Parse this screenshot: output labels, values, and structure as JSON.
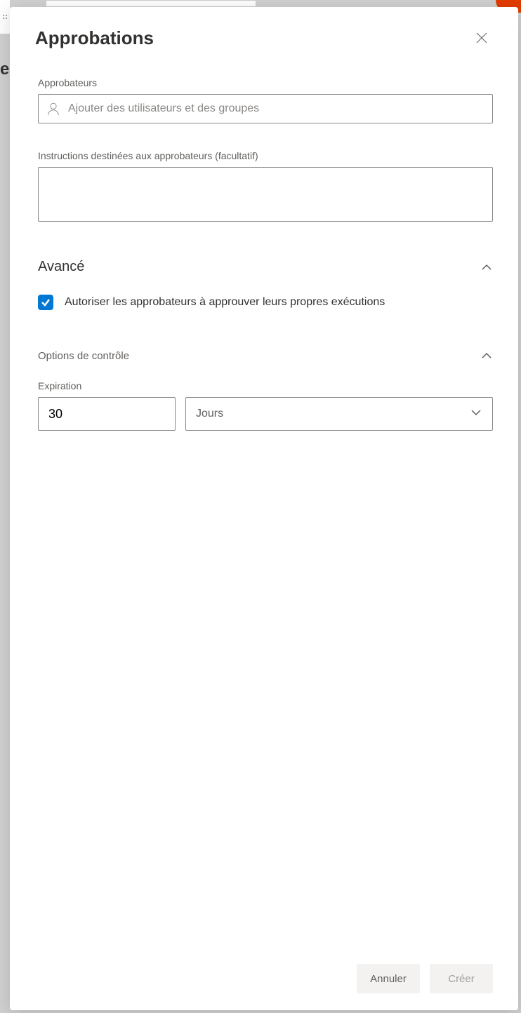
{
  "panel": {
    "title": "Approbations"
  },
  "approvers": {
    "label": "Approbateurs",
    "placeholder": "Ajouter des utilisateurs et des groupes"
  },
  "instructions": {
    "label": "Instructions destinées aux approbateurs (facultatif)",
    "value": ""
  },
  "advanced": {
    "title": "Avancé",
    "allow_self_approve_label": "Autoriser les approbateurs à approuver leurs propres exécutions",
    "allow_self_approve_checked": true
  },
  "control": {
    "title": "Options de contrôle",
    "expiration_label": "Expiration",
    "expiration_value": "30",
    "expiration_unit": "Jours"
  },
  "footer": {
    "cancel": "Annuler",
    "create": "Créer"
  }
}
